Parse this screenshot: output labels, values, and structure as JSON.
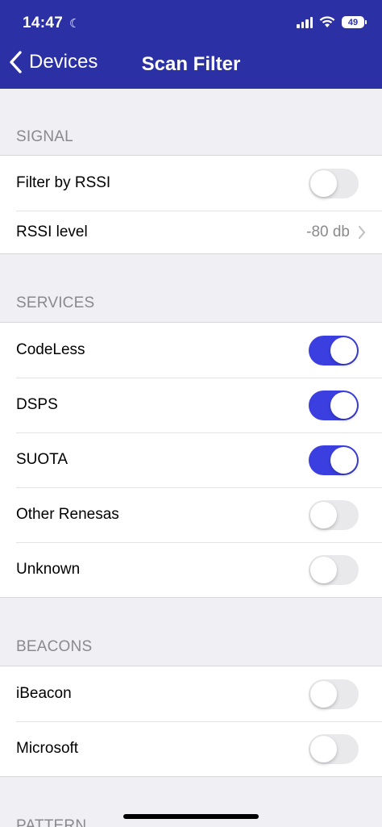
{
  "status_bar": {
    "time": "14:47",
    "battery": "49"
  },
  "nav": {
    "back_label": "Devices",
    "title": "Scan Filter"
  },
  "sections": {
    "signal": {
      "header": "SIGNAL",
      "filter_by_rssi": {
        "label": "Filter by RSSI",
        "on": false
      },
      "rssi_level": {
        "label": "RSSI level",
        "value": "-80 db"
      }
    },
    "services": {
      "header": "SERVICES",
      "items": [
        {
          "label": "CodeLess",
          "on": true
        },
        {
          "label": "DSPS",
          "on": true
        },
        {
          "label": "SUOTA",
          "on": true
        },
        {
          "label": "Other Renesas",
          "on": false
        },
        {
          "label": "Unknown",
          "on": false
        }
      ]
    },
    "beacons": {
      "header": "BEACONS",
      "items": [
        {
          "label": "iBeacon",
          "on": false
        },
        {
          "label": "Microsoft",
          "on": false
        }
      ]
    },
    "pattern": {
      "header": "PATTERN"
    }
  },
  "colors": {
    "nav_bar": "#2b31a5",
    "toggle_on": "#3b3fe0",
    "toggle_off": "#e9e9eb",
    "background": "#efeff4"
  }
}
